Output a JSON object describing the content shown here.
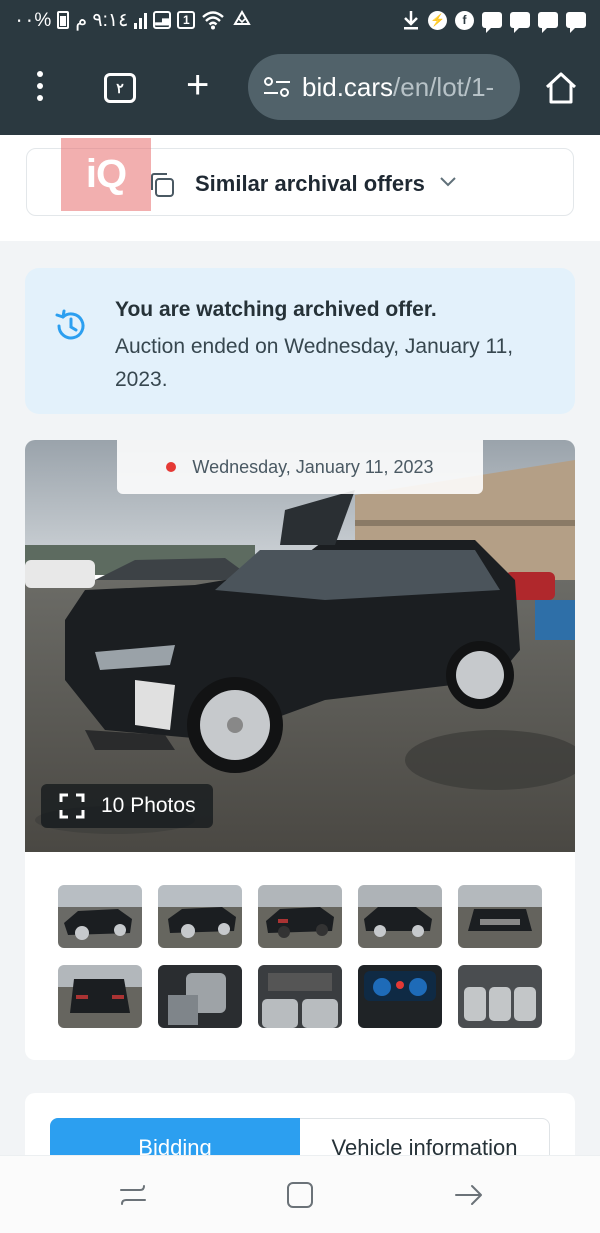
{
  "status_bar": {
    "time": "٩:١٤ م",
    "battery": "%٠٠",
    "sim_badge": "1"
  },
  "browser": {
    "tab_count": "٢",
    "url_host": "bid.cars",
    "url_path": "/en/lot/1-"
  },
  "page": {
    "watermark": "iQ",
    "similar_offers_label": "Similar archival offers",
    "archived_notice": {
      "title": "You are watching archived offer.",
      "text": "Auction ended on Wednesday, January 11, 2023."
    },
    "gallery": {
      "date_label": "Wednesday, January 11, 2023",
      "photos_count_label": "10 Photos",
      "thumbnails": [
        {
          "name": "thumb-1"
        },
        {
          "name": "thumb-2"
        },
        {
          "name": "thumb-3"
        },
        {
          "name": "thumb-4"
        },
        {
          "name": "thumb-5"
        },
        {
          "name": "thumb-6"
        },
        {
          "name": "thumb-7"
        },
        {
          "name": "thumb-8"
        },
        {
          "name": "thumb-9"
        },
        {
          "name": "thumb-10"
        }
      ]
    },
    "tabs": {
      "bidding": "Bidding",
      "vehicle_information": "Vehicle information"
    }
  },
  "colors": {
    "toolbar_bg": "#2b3940",
    "accent_blue": "#2c9ff0",
    "notice_bg": "#e3f1fb",
    "date_dot": "#e53935"
  },
  "icons": [
    "menu-dots-icon",
    "tabs-icon",
    "plus-icon",
    "site-settings-icon",
    "home-icon",
    "copy-icon",
    "chevron-down-icon",
    "history-icon",
    "expand-icon",
    "recent-apps-icon",
    "home-nav-icon",
    "back-icon"
  ]
}
